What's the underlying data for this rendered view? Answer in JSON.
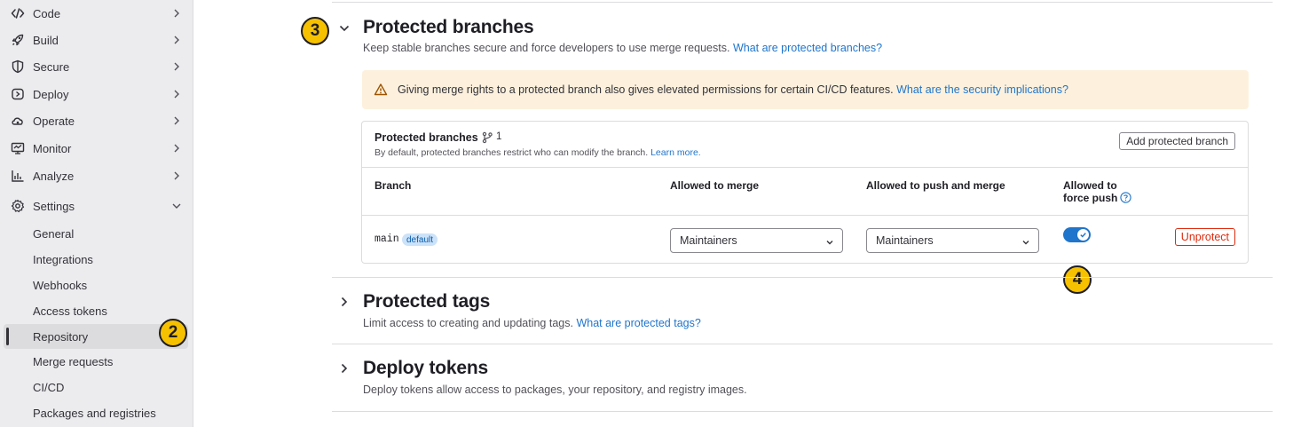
{
  "sidebar": {
    "items": [
      {
        "label": "Code",
        "icon": "code-icon"
      },
      {
        "label": "Build",
        "icon": "rocket-icon"
      },
      {
        "label": "Secure",
        "icon": "shield-icon"
      },
      {
        "label": "Deploy",
        "icon": "deploy-icon"
      },
      {
        "label": "Operate",
        "icon": "cloud-gear-icon"
      },
      {
        "label": "Monitor",
        "icon": "monitor-icon"
      },
      {
        "label": "Analyze",
        "icon": "chart-icon"
      },
      {
        "label": "Settings",
        "icon": "gear-icon"
      }
    ],
    "settings_sub": [
      {
        "label": "General"
      },
      {
        "label": "Integrations"
      },
      {
        "label": "Webhooks"
      },
      {
        "label": "Access tokens"
      },
      {
        "label": "Repository"
      },
      {
        "label": "Merge requests"
      },
      {
        "label": "CI/CD"
      },
      {
        "label": "Packages and registries"
      }
    ]
  },
  "callouts": {
    "two": "2",
    "three": "3",
    "four": "4"
  },
  "protected_branches": {
    "title": "Protected branches",
    "desc": "Keep stable branches secure and force developers to use merge requests.",
    "link": "What are protected branches?",
    "alert_text": "Giving merge rights to a protected branch also gives elevated permissions for certain CI/CD features.",
    "alert_link": "What are the security implications?",
    "card": {
      "title": "Protected branches",
      "count": "1",
      "subtitle": "By default, protected branches restrict who can modify the branch.",
      "learn_more": "Learn more.",
      "add_button": "Add protected branch"
    },
    "columns": {
      "branch": "Branch",
      "allowed_merge": "Allowed to merge",
      "allowed_push": "Allowed to push and merge",
      "force_push_1": "Allowed to",
      "force_push_2": "force push"
    },
    "row": {
      "branch": "main",
      "badge": "default",
      "merge_value": "Maintainers",
      "push_value": "Maintainers",
      "force_push_enabled": true,
      "unprotect": "Unprotect"
    }
  },
  "protected_tags": {
    "title": "Protected tags",
    "desc": "Limit access to creating and updating tags.",
    "link": "What are protected tags?"
  },
  "deploy_tokens": {
    "title": "Deploy tokens",
    "desc": "Deploy tokens allow access to packages, your repository, and registry images."
  },
  "colors": {
    "accent": "#1f75cb",
    "danger": "#dd2b0e",
    "callout": "#f6c100",
    "alert_bg": "#fdf1dd"
  }
}
